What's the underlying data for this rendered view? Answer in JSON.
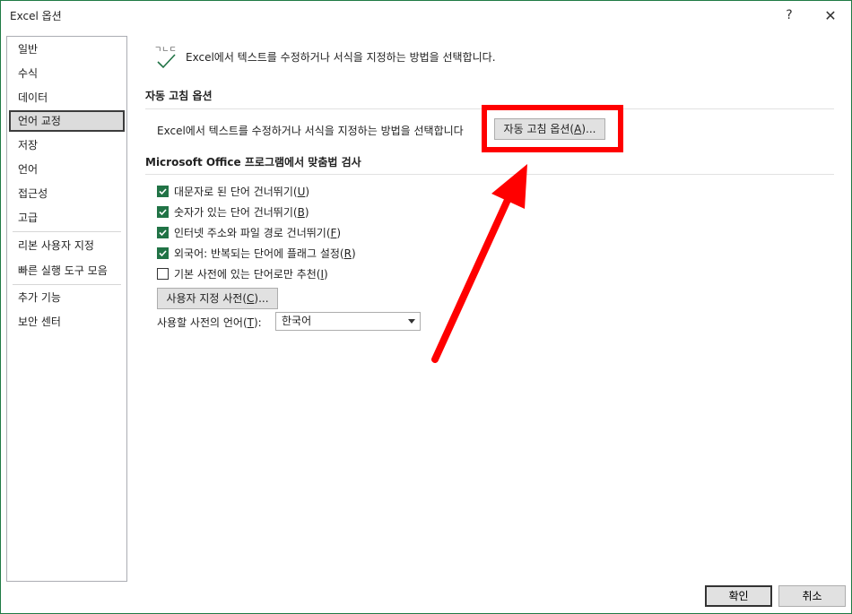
{
  "window": {
    "title": "Excel 옵션",
    "help_label": "?",
    "close_label": "✕"
  },
  "sidebar": {
    "items": [
      {
        "label": "일반"
      },
      {
        "label": "수식"
      },
      {
        "label": "데이터"
      },
      {
        "label": "언어 교정",
        "selected": true
      },
      {
        "label": "저장"
      },
      {
        "label": "언어"
      },
      {
        "label": "접근성"
      },
      {
        "label": "고급"
      },
      {
        "label": "리본 사용자 지정"
      },
      {
        "label": "빠른 실행 도구 모음"
      },
      {
        "label": "추가 기능"
      },
      {
        "label": "보안 센터"
      }
    ]
  },
  "main": {
    "intro_icon_text": "ㄱㄴㄷ",
    "intro_text": "Excel에서 텍스트를 수정하거나 서식을 지정하는 방법을 선택합니다.",
    "autocorrect": {
      "heading": "자동 고침 옵션",
      "description": "Excel에서 텍스트를 수정하거나 서식을 지정하는 방법을 선택합니다",
      "button_label": "자동 고침 옵션(A)...",
      "button_text": "자동 고침 옵션(",
      "button_key": "A",
      "button_suffix": ")..."
    },
    "spelling": {
      "heading": "Microsoft Office 프로그램에서 맞춤법 검사",
      "options": [
        {
          "text": "대문자로 된 단어 건너뛰기(",
          "key": "U",
          "suffix": ")",
          "checked": true
        },
        {
          "text": "숫자가 있는 단어 건너뛰기(",
          "key": "B",
          "suffix": ")",
          "checked": true
        },
        {
          "text": "인터넷 주소와 파일 경로 건너뛰기(",
          "key": "F",
          "suffix": ")",
          "checked": true
        },
        {
          "text": "외국어: 반복되는 단어에 플래그 설정(",
          "key": "R",
          "suffix": ")",
          "checked": true
        },
        {
          "text": "기본 사전에 있는 단어로만 추천(",
          "key": "I",
          "suffix": ")",
          "checked": false
        }
      ],
      "custom_dict_text": "사용자 지정 사전(",
      "custom_dict_key": "C",
      "custom_dict_suffix": ")...",
      "language_label_text": "사용할 사전의 언어(",
      "language_label_key": "T",
      "language_label_suffix": "):",
      "language_value": "한국어"
    }
  },
  "footer": {
    "ok_label": "확인",
    "cancel_label": "취소"
  },
  "colors": {
    "accent": "#217346",
    "highlight": "#ff0000",
    "window_border": "#1f7a45"
  }
}
